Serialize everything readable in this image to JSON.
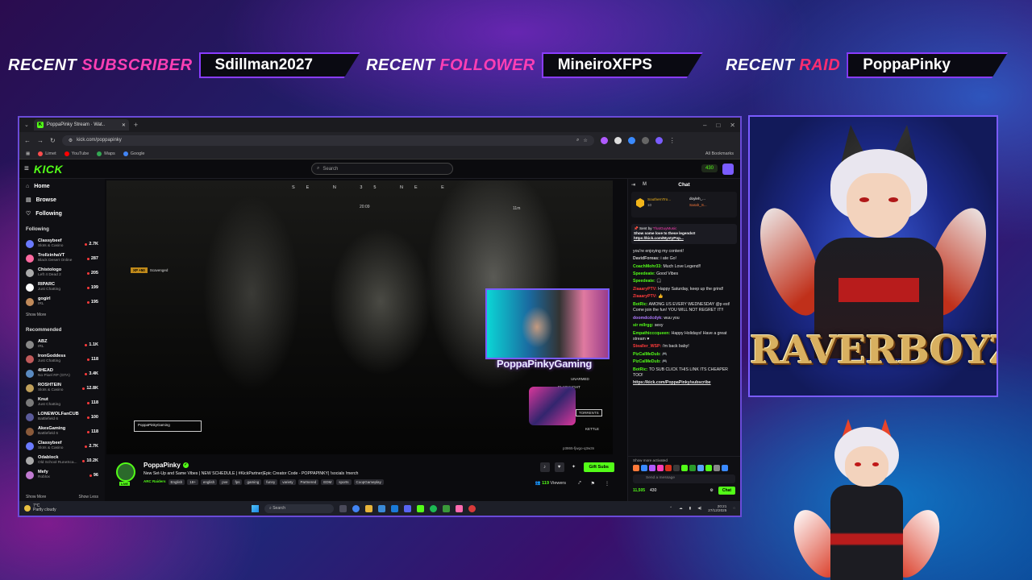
{
  "banner": {
    "subscriber": {
      "label_white": "RECENT",
      "label_color": "SUBSCRIBER",
      "value": "Sdillman2027"
    },
    "follower": {
      "label_white": "RECENT",
      "label_color": "FOLLOWER",
      "value": "MineiroXFPS"
    },
    "raid": {
      "label_white": "RECENT",
      "label_color": "RAID",
      "value": "PoppaPinky"
    }
  },
  "browser": {
    "tab_title": "PoppaPinky Stream · Wat..",
    "url": "kick.com/poppapinky",
    "bookmarks": [
      {
        "label": "Limet",
        "color": "#ff4d4d"
      },
      {
        "label": "YouTube",
        "color": "#ff0000"
      },
      {
        "label": "Maps",
        "color": "#34a853"
      },
      {
        "label": "Google",
        "color": "#4285f4"
      }
    ],
    "all_bookmarks": "All Bookmarks"
  },
  "kick": {
    "logo": "KICK",
    "search_placeholder": "Search",
    "points": "430",
    "nav": [
      {
        "icon": "home-icon",
        "glyph": "⌂",
        "label": "Home"
      },
      {
        "icon": "browse-icon",
        "glyph": "▤",
        "label": "Browse"
      },
      {
        "icon": "heart-icon",
        "glyph": "♡",
        "label": "Following"
      }
    ],
    "following_title": "Following",
    "following": [
      {
        "name": "Classybeef",
        "game": "Slots & Casino",
        "viewers": "2.7K",
        "color": "#6a7aff"
      },
      {
        "name": "TrollzinhaVT",
        "game": "Black Desert Online",
        "viewers": "287",
        "color": "#ff6aa0"
      },
      {
        "name": "Chistologo",
        "game": "Left 4 Dead 2",
        "viewers": "205",
        "color": "#aaaaaa"
      },
      {
        "name": "RIPARC",
        "game": "Just Chatting",
        "viewers": "199",
        "color": "#ffffff"
      },
      {
        "name": "gogirl",
        "game": "IRL",
        "viewers": "195",
        "color": "#c08a5a"
      }
    ],
    "following_more": "Show More",
    "recommended_title": "Recommended",
    "recommended": [
      {
        "name": "ABZ",
        "game": "IRL",
        "viewers": "1.1K",
        "color": "#888888"
      },
      {
        "name": "IronGoddess",
        "game": "Just Chatting",
        "viewers": "118",
        "color": "#c05a5a"
      },
      {
        "name": "4HEAD",
        "game": "No Pixel RP (GTA)",
        "viewers": "3.4K",
        "color": "#5a8ac0"
      },
      {
        "name": "ROSHTEIN",
        "game": "Slots & Casino",
        "viewers": "12.8K",
        "color": "#c0a05a"
      },
      {
        "name": "Knut",
        "game": "Just Chatting",
        "viewers": "118",
        "color": "#7a7a7a"
      },
      {
        "name": "LONEWOLFanCUB",
        "game": "Battlefield 6",
        "viewers": "100",
        "color": "#5a5a9a"
      },
      {
        "name": "AkesGaming",
        "game": "Battlefield 6",
        "viewers": "118",
        "color": "#8a5a3a"
      },
      {
        "name": "Classybeef",
        "game": "Slots & Casino",
        "viewers": "2.7K",
        "color": "#6a7aff"
      },
      {
        "name": "Odablock",
        "game": "Old School RuneSca...",
        "viewers": "10.2K",
        "color": "#aaaaaa"
      },
      {
        "name": "Mefy",
        "game": "Roblox",
        "viewers": "96",
        "color": "#c07ad0"
      }
    ],
    "show_more": "Show More",
    "show_less": "Show Less"
  },
  "video": {
    "hud_compass": "SE  N  35 NE  E",
    "hud_time": "20:09",
    "hud_dist": "11m",
    "hud_tag": "Scavenged",
    "hud_tag_badge": "XP +50",
    "hud_name": "PoppaPinkyGaming",
    "cam_name": "PoppaPinkyGaming",
    "hud_unarmed": "UNARMED",
    "hud_flash": "FLASHLIGHT",
    "hud_torrent": "TORRENTS",
    "hud_kettle": "KETTLE",
    "hud_code": "p3865-fjwgo-q3w3n"
  },
  "stream": {
    "name": "PoppaPinky",
    "live": "LIVE",
    "title": "New Set-Up and Same Vibes | NEW SCHEDULE | #KickPartner|Epic Creator Code - POPPAPINKY| !socials !merch",
    "category": "ARC Raiders",
    "tags": [
      "English",
      "18+",
      "english",
      "pve",
      "fps",
      "gaming",
      "funny",
      "variety",
      "Partnered",
      "EDM",
      "sports",
      "CoopGameplay"
    ],
    "gift_subs": "Gift Subs",
    "viewers": "119",
    "viewers_label": "Viewers"
  },
  "chat": {
    "title": "Chat",
    "leaders": [
      "SouthernTro...",
      "10",
      "doyleh_...",
      "Sarah_S..."
    ],
    "pinned_sort": "Sent by",
    "pinned_user": "ThatGuyMusic",
    "pinned_text": "Show some love to these legends!!",
    "pinned_link": "https://kick.com/MystyPop...",
    "messages": [
      {
        "user": "",
        "color": "#e8e8e8",
        "text": "you're enjoying my content!"
      },
      {
        "user": "DavidForeas:",
        "color": "#cfcfcf",
        "text": "i ate Go!"
      },
      {
        "user": "CoachMohr33:",
        "color": "#53fc18",
        "text": "Much Love Legend!!"
      },
      {
        "user": "Speedeate:",
        "color": "#53fc18",
        "text": "Good Vibes"
      },
      {
        "user": "Speedeate:",
        "color": "#53fc18",
        "text": "🎧"
      },
      {
        "user": "ZiaaaryPTV:",
        "color": "#ff3b3b",
        "text": "Happy Saturday, keep up the grind!"
      },
      {
        "user": "ZiaaaryPTV:",
        "color": "#ff3b3b",
        "text": "👍"
      },
      {
        "user": "BotRic:",
        "color": "#53fc18",
        "text": "AMONG US EVERY WEDNESDAY @p est! Come join the fun! YOU WILL NOT REGRET IT!!"
      },
      {
        "user": "doomdcdcdyk:",
        "color": "#b07aff",
        "text": "wuu you"
      },
      {
        "user": "sir mllrgg:",
        "color": "#53fc18",
        "text": "sexy"
      },
      {
        "user": "Empathicccqueen:",
        "color": "#53fc18",
        "text": "Happy Holidays! Have a great stream ♥"
      },
      {
        "user": "Stealler_WSP:",
        "color": "#ff3b3b",
        "text": "i'm back baby!"
      },
      {
        "user": "PizCalMeDub:",
        "color": "#53fc18",
        "text": "🎮"
      },
      {
        "user": "PizCalMeDub:",
        "color": "#53fc18",
        "text": "🎮"
      },
      {
        "user": "BotRic:",
        "color": "#53fc18",
        "text": "TO SUB CLICK THIS LINK ITS CHEAPER TOO!"
      },
      {
        "user": "",
        "color": "#ffffff",
        "text": "https://kick.com/PoppaPinky/subscribe"
      }
    ],
    "show_more_active": "Show more activated",
    "emote_colors": [
      "#ff7a3a",
      "#3a8aff",
      "#b05aff",
      "#ff3fb4",
      "#d8321c",
      "#3a3a3a",
      "#53fc18",
      "#2a9a2a",
      "#5aa0ff",
      "#53fc18",
      "#888888",
      "#3a8aff"
    ],
    "input_placeholder": "Send a message",
    "points": "11,505",
    "count": "430",
    "send": "Chat"
  },
  "taskbar": {
    "temp": "7°C",
    "weather": "Partly cloudy",
    "search": "Search",
    "time": "20:21",
    "date": "27/12/2025"
  },
  "overlay": {
    "logo": "RAVERBOYZ"
  },
  "colors": {
    "accent": "#53fc18",
    "frame": "#7a5cff",
    "pink": "#ff3fb4"
  }
}
